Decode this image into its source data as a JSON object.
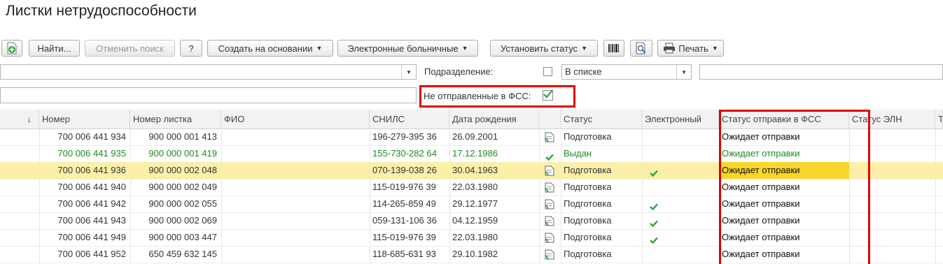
{
  "page": {
    "title": "Листки нетрудоспособности"
  },
  "toolbar": {
    "add_icon": "add-document-icon",
    "find": "Найти...",
    "cancel_search": "Отменить поиск",
    "help": "?",
    "create_based_on": "Создать на основании",
    "electronic_sick": "Электронные больничные",
    "set_status": "Установить статус",
    "barcode_icon": "barcode-icon",
    "preview_icon": "print-preview-icon",
    "print": "Печать"
  },
  "filters": {
    "subdivision_label": "Подразделение:",
    "subdivision_mode": "В списке",
    "not_sent_label": "Не отправленные в ФСС:",
    "not_sent_checked": true
  },
  "table": {
    "columns": [
      "↓",
      "Номер",
      "Номер листка",
      "ФИО",
      "СНИЛС",
      "Дата рождения",
      "",
      "Статус",
      "Электронный",
      "Статус отправки в ФСС",
      "Статус ЭЛН",
      "Т"
    ],
    "rows": [
      {
        "number": "700 006 441 934",
        "sheet": "900 000 001 413",
        "fio": "",
        "snils": "196-279-395 36",
        "birth": "26.09.2001",
        "icon": "document-icon",
        "status": "Подготовка",
        "electronic": false,
        "fss": "Ожидает отправки",
        "green": false,
        "selected": false
      },
      {
        "number": "700 006 441 935",
        "sheet": "900 000 001 419",
        "fio": "",
        "snils": "155-730-282 64",
        "birth": "17.12.1986",
        "icon": "check-icon",
        "status": "Выдан",
        "electronic": false,
        "fss": "Ожидает отправки",
        "green": true,
        "selected": false
      },
      {
        "number": "700 006 441 936",
        "sheet": "900 000 002 048",
        "fio": "",
        "snils": "070-139-038 26",
        "birth": "30.04.1963",
        "icon": "document-icon",
        "status": "Подготовка",
        "electronic": true,
        "fss": "Ожидает отправки",
        "green": false,
        "selected": true
      },
      {
        "number": "700 006 441 940",
        "sheet": "900 000 002 049",
        "fio": "",
        "snils": "115-019-976 39",
        "birth": "22.03.1980",
        "icon": "document-icon",
        "status": "Подготовка",
        "electronic": false,
        "fss": "Ожидает отправки",
        "green": false,
        "selected": false
      },
      {
        "number": "700 006 441 942",
        "sheet": "900 000 002 055",
        "fio": "",
        "snils": "114-265-859 49",
        "birth": "29.12.1977",
        "icon": "document-icon",
        "status": "Подготовка",
        "electronic": true,
        "fss": "Ожидает отправки",
        "green": false,
        "selected": false
      },
      {
        "number": "700 006 441 943",
        "sheet": "900 000 002 069",
        "fio": "",
        "snils": "059-131-106 36",
        "birth": "04.12.1959",
        "icon": "document-icon",
        "status": "Подготовка",
        "electronic": true,
        "fss": "Ожидает отправки",
        "green": false,
        "selected": false
      },
      {
        "number": "700 006 441 949",
        "sheet": "900 000 003 447",
        "fio": "",
        "snils": "115-019-976 39",
        "birth": "22.03.1980",
        "icon": "document-icon",
        "status": "Подготовка",
        "electronic": true,
        "fss": "Ожидает отправки",
        "green": false,
        "selected": false
      },
      {
        "number": "700 006 441 952",
        "sheet": "650 459 632 145",
        "fio": "",
        "snils": "118-685-631 93",
        "birth": "29.10.1982",
        "icon": "document-icon",
        "status": "Подготовка",
        "electronic": false,
        "fss": "Ожидает отправки",
        "green": false,
        "selected": false
      }
    ]
  },
  "colors": {
    "highlight_box": "#e00000",
    "selected_row": "#fbefaa",
    "selected_cell": "#f9d62b",
    "green_text": "#1e8a1e"
  }
}
